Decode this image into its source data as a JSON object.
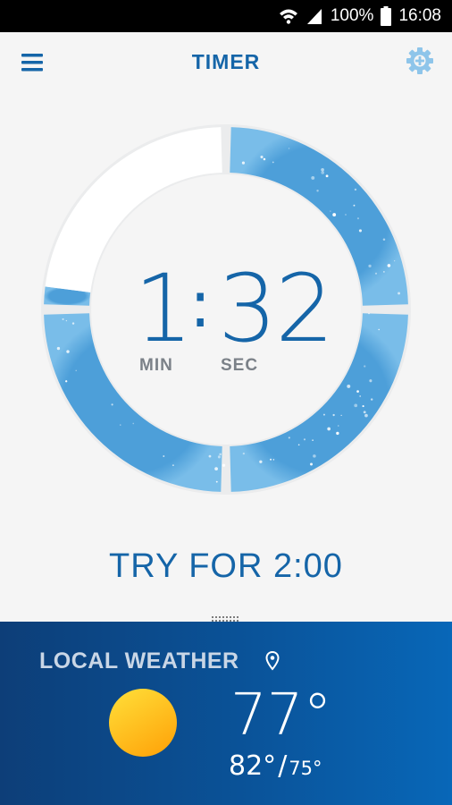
{
  "status_bar": {
    "battery": "100%",
    "time": "16:08"
  },
  "app_bar": {
    "title": "TIMER"
  },
  "timer": {
    "minutes": "1",
    "colon": ":",
    "seconds": "32",
    "min_label": "MIN",
    "sec_label": "SEC",
    "elapsed_fraction": 0.77
  },
  "try_label": "TRY FOR 2:00",
  "weather": {
    "title": "LOCAL WEATHER",
    "condition_icon": "sun-icon",
    "current_temp": "77°",
    "high_temp": "82°",
    "separator": "/",
    "low_temp": "75°"
  },
  "colors": {
    "accent": "#1565a8",
    "ring_fill": "#5aa8dd",
    "ring_empty": "#ffffff",
    "weather_bg": "#0a5399"
  }
}
